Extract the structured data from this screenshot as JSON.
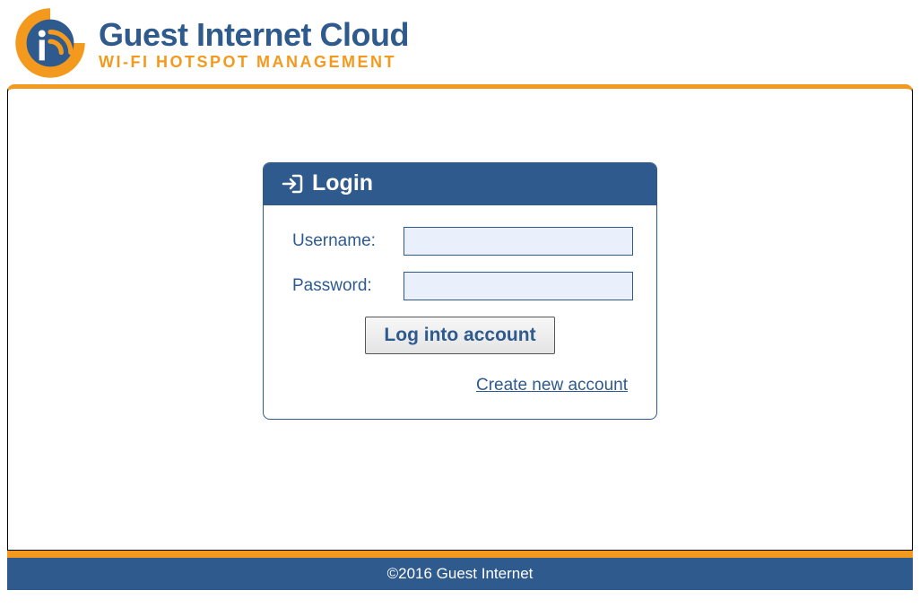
{
  "brand": {
    "title": "Guest Internet Cloud",
    "subtitle": "WI-FI HOTSPOT MANAGEMENT"
  },
  "login": {
    "heading": "Login",
    "username_label": "Username:",
    "username_value": "",
    "password_label": "Password:",
    "password_value": "",
    "button_label": "Log into account",
    "create_link": "Create new account"
  },
  "footer": {
    "copyright": "©2016 Guest Internet"
  },
  "colors": {
    "brand_blue": "#2e5a8e",
    "brand_orange": "#f39a1e",
    "input_bg": "#e9f0fb"
  }
}
